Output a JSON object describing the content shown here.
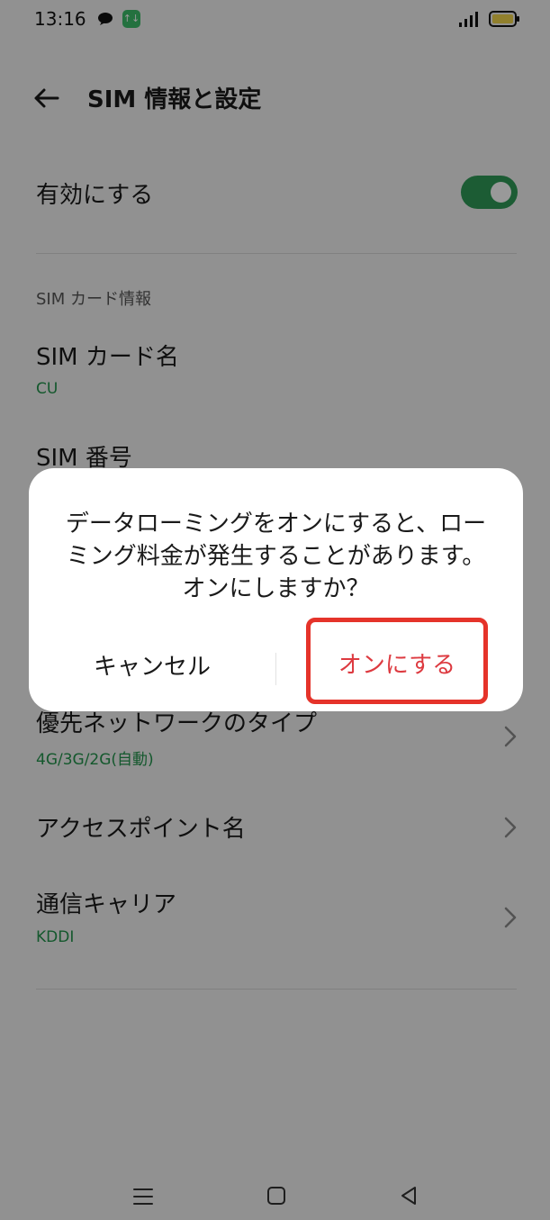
{
  "status_bar": {
    "time": "13:16",
    "data_badge": "↑↓"
  },
  "header": {
    "title": "SIM 情報と設定"
  },
  "settings": {
    "enable_label": "有効にする",
    "enable_state": true,
    "section_header": "SIM カード情報",
    "sim_name_label": "SIM カード名",
    "sim_name_value": "CU",
    "sim_number_label": "SIM 番号",
    "network_type_label": "優先ネットワークのタイプ",
    "network_type_value": "4G/3G/2G(自動)",
    "apn_label": "アクセスポイント名",
    "carrier_label": "通信キャリア",
    "carrier_value": "KDDI"
  },
  "dialog": {
    "message": "データローミングをオンにすると、ローミング料金が発生することがあります。オンにしますか？",
    "cancel_label": "キャンセル",
    "confirm_label": "オンにする"
  },
  "colors": {
    "accent_green": "#2f9a58",
    "confirm_red": "#dd3a40",
    "highlight_border": "#e5332a"
  }
}
